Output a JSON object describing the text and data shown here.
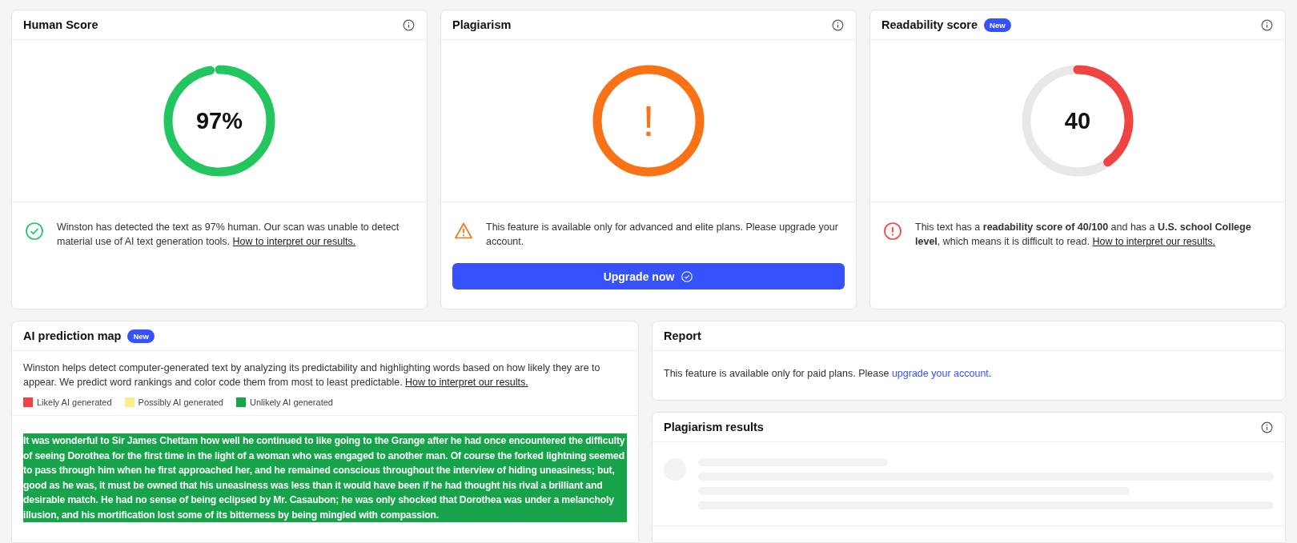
{
  "score_cards": [
    {
      "title": "Human Score",
      "info": true,
      "gauge": {
        "kind": "percent",
        "reading": "97%"
      },
      "message": {
        "kind": "success",
        "text": "Winston has detected the text as 97% human. Our scan was unable to detect material use of AI text generation tools.",
        "link": "How to interpret our results."
      }
    },
    {
      "title": "Plagiarism",
      "info": true,
      "gauge": {
        "kind": "locked",
        "reading": "!"
      },
      "message": {
        "kind": "warning",
        "text": "This feature is available only for advanced and elite plans. Please upgrade your account."
      },
      "button": {
        "label": "Upgrade now"
      }
    },
    {
      "title": "Readability score",
      "badge": "New",
      "info": true,
      "gauge": {
        "kind": "score",
        "reading": "40"
      },
      "message": {
        "kind": "error",
        "text": "This text has a **readability score of 40/100** and has a **U.S. school College level**, which means it is difficult to read.",
        "link": "How to interpret our results."
      }
    }
  ],
  "prediction_map": {
    "title": "AI prediction map",
    "badge": "New",
    "description": "Winston helps detect computer-generated text by analyzing its predictability and highlighting words based on how likely they are to appear. We predict word rankings and color code them from most to least predictable.",
    "link": "How to interpret our results.",
    "legend": [
      {
        "kind": "likely",
        "label": "Likely AI generated",
        "color": "#ef4444"
      },
      {
        "kind": "possibly",
        "label": "Possibly AI generated",
        "color": "#fdeb8f"
      },
      {
        "kind": "unlikely",
        "label": "Unlikely AI generated",
        "color": "#16a34a"
      }
    ],
    "segments": [
      {
        "kind": "unlikely",
        "text": "It was wonderful to Sir James Chettam how well he continued to like going to the Grange after he had once encountered the difficulty of seeing Dorothea for the first time in the light of a woman who was engaged to another man. Of course the forked lightning seemed to pass through him when he first approached her, and he remained conscious throughout the interview of hiding uneasiness; but, good as he was, it must be owned that his uneasiness was less than it would have been if he had thought his rival a brilliant and desirable match. He had no sense of being eclipsed by Mr. Casaubon; he was only shocked that Dorothea was under a melancholy illusion, and his mortification lost some of its bitterness by being mingled with compassion."
      }
    ]
  },
  "report": {
    "title": "Report",
    "text": "This feature is available only for paid plans. Please",
    "link": "upgrade your account",
    "after": "."
  },
  "plagiarism_results": {
    "title": "Plagiarism results",
    "info": true,
    "loading": true
  }
}
